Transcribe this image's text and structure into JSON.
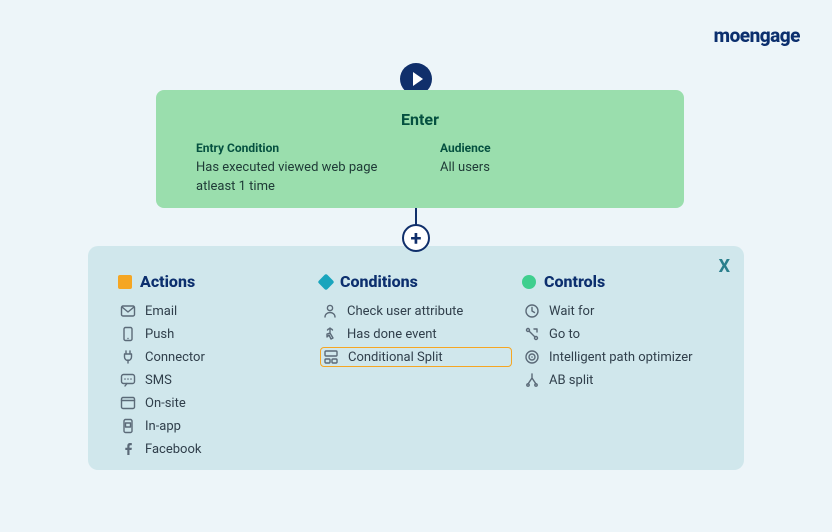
{
  "brand": "moengage",
  "enter": {
    "title": "Enter",
    "entry_condition_label": "Entry Condition",
    "entry_condition_text": "Has executed viewed web page atleast 1 time",
    "audience_label": "Audience",
    "audience_text": "All users"
  },
  "panel": {
    "close": "X",
    "columns": {
      "actions": {
        "title": "Actions",
        "items": [
          {
            "label": "Email",
            "icon": "mail"
          },
          {
            "label": "Push",
            "icon": "phone"
          },
          {
            "label": "Connector",
            "icon": "plug"
          },
          {
            "label": "SMS",
            "icon": "sms"
          },
          {
            "label": "On-site",
            "icon": "window"
          },
          {
            "label": "In-app",
            "icon": "inapp"
          },
          {
            "label": "Facebook",
            "icon": "facebook"
          }
        ]
      },
      "conditions": {
        "title": "Conditions",
        "items": [
          {
            "label": "Check user attribute",
            "icon": "user"
          },
          {
            "label": "Has done event",
            "icon": "tap"
          },
          {
            "label": "Conditional Split",
            "icon": "split",
            "highlight": true
          }
        ]
      },
      "controls": {
        "title": "Controls",
        "items": [
          {
            "label": "Wait for",
            "icon": "clock"
          },
          {
            "label": "Go to",
            "icon": "goto"
          },
          {
            "label": "Intelligent path optimizer",
            "icon": "target"
          },
          {
            "label": "AB split",
            "icon": "ab"
          }
        ]
      }
    }
  }
}
